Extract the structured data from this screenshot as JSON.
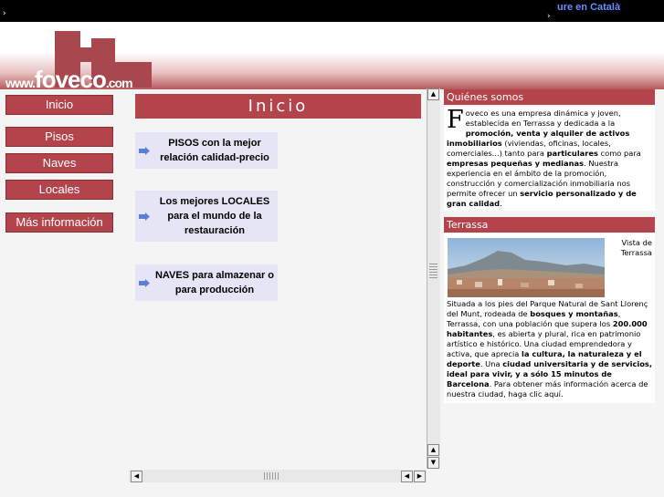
{
  "topbar": {
    "ticker": "ure en Català",
    "arrow": "›"
  },
  "logo": {
    "prefix": "www.",
    "name": "foveco",
    "suffix": ".com"
  },
  "nav": {
    "items": [
      {
        "label": "Inicio"
      },
      {
        "label": "Pisos"
      },
      {
        "label": "Naves"
      },
      {
        "label": "Locales"
      },
      {
        "label": "Más información"
      }
    ]
  },
  "main": {
    "title": "Inicio",
    "promos": [
      {
        "icon": "arrow-icon",
        "text": "PISOS con la mejor relación calidad-precio"
      },
      {
        "icon": "arrow-icon",
        "text": "Los mejores LOCALES para el mundo de la restauración"
      },
      {
        "icon": "arrow-icon",
        "text": "NAVES para almazenar o para producción"
      }
    ]
  },
  "quienes": {
    "heading": "Quiénes somos",
    "dropcap": "F",
    "p1": "oveco es una empresa dinámica y joven, establecida en Terrassa y dedicada a la ",
    "b1": "promoción, venta y alquiler de activos inmobiliarios",
    "p2": " (viviendas, oficinas, locales, comerciales...) tanto para ",
    "b2": "particulares",
    "p3": " como para ",
    "b3": "empresas pequeñas y medianas",
    "p4": ". Nuestra experiencia en el ámbito de la promoción, construcción y comercialización inmobiliaria nos permite ofrecer un ",
    "b4": "servicio personalizado y de gran calidad",
    "p5": "."
  },
  "terrassa": {
    "heading": "Terrassa",
    "caption": "Vista de Terrassa",
    "p1": "Situada a los pies del Parque Natural de Sant Llorenç del Munt, rodeada de ",
    "b1": "bosques y montañas",
    "p2": ", Terrassa, con una población que supera los ",
    "b2": "200.000 habitantes",
    "p3": ", es abierta y plural, rica en patrimonio artístico e histórico. Una ciudad emprendedora y activa, que aprecia ",
    "b3": "la cultura, la naturaleza y el deporte",
    "p4": ". Una ",
    "b4": "ciudad universitaria y de servicios, ideal para vivir, y a sólo 15 minutos de Barcelona",
    "p5": ". Para obtener más información acerca de nuestra ciudad, haga clic aquí."
  },
  "colors": {
    "accent": "#b3444b",
    "promo_bg": "#e5e5f5"
  }
}
